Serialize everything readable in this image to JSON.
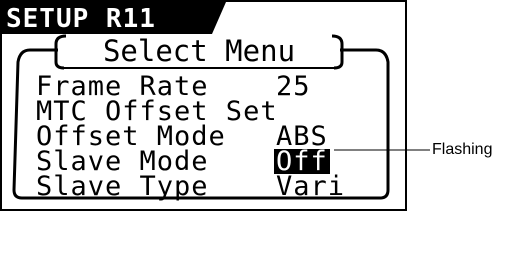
{
  "screen": {
    "title": "SETUP R11",
    "menu_title": "Select Menu"
  },
  "menu": {
    "items": [
      {
        "label": "Frame Rate",
        "value": "25"
      },
      {
        "label": "MTC Offset Set",
        "value": ""
      },
      {
        "label": "Offset Mode",
        "value": "ABS"
      },
      {
        "label": "Slave Mode",
        "value": "Off",
        "highlighted": true
      },
      {
        "label": "Slave Type",
        "value": "Vari"
      }
    ]
  },
  "annotation": {
    "label": "Flashing"
  },
  "colors": {
    "foreground": "#000000",
    "background": "#ffffff",
    "highlight_text": "#ffffff"
  }
}
